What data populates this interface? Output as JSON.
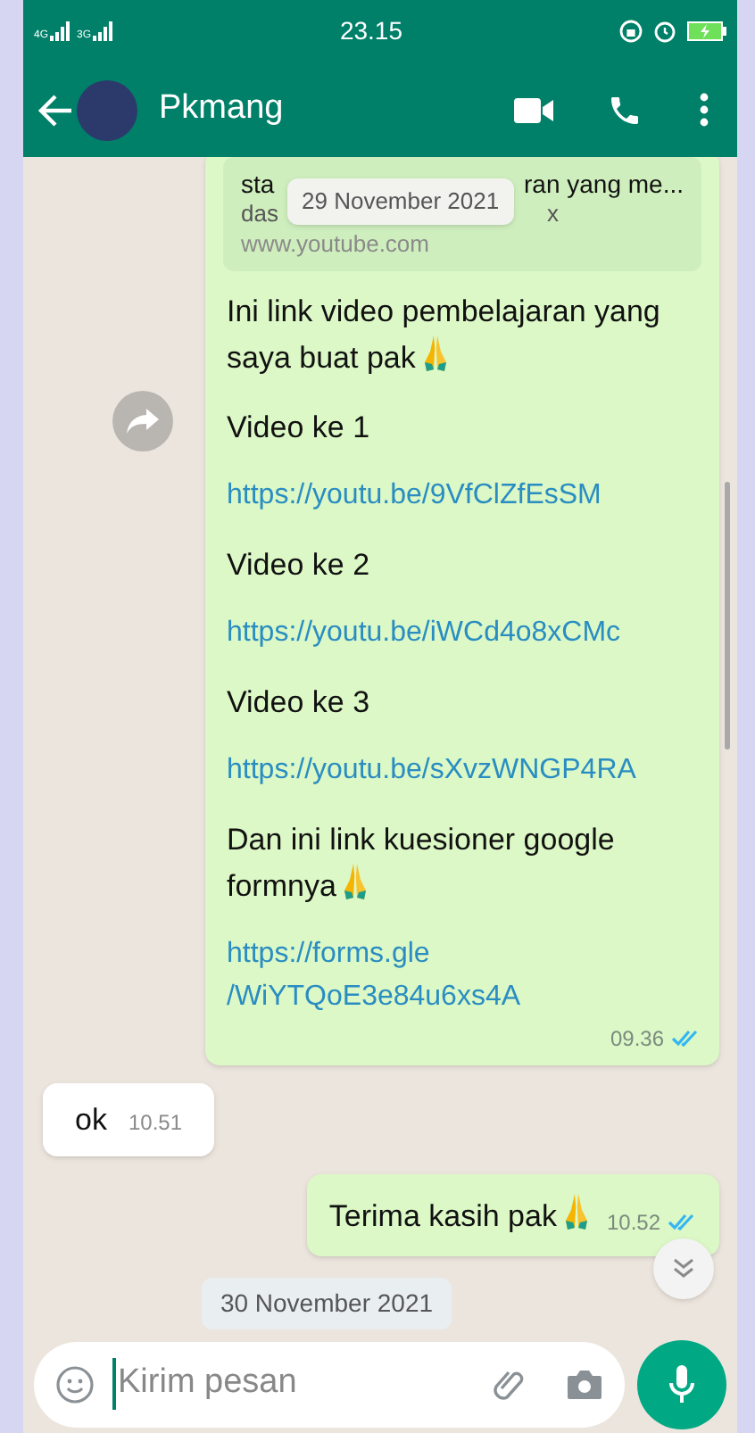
{
  "status_bar": {
    "network_labels": [
      "4G",
      "3G"
    ],
    "time": "23.15"
  },
  "header": {
    "contact_name": "Pkmang"
  },
  "floating_date": "29 November 2021",
  "messages": [
    {
      "kind": "outgoing",
      "preview": {
        "title_parts": [
          "sta",
          "ran yang me..."
        ],
        "description_parts": [
          "das",
          "x"
        ],
        "domain": "www.youtube.com"
      },
      "forward_button": true,
      "lines": [
        {
          "kind": "text_with_praying_emoji",
          "text": "Ini link video pembelajaran yang saya buat pak"
        },
        {
          "kind": "text",
          "text": "Video ke 1"
        },
        {
          "kind": "link",
          "text": "https://youtu.be/9VfClZfEsSM"
        },
        {
          "kind": "text",
          "text": "Video ke 2"
        },
        {
          "kind": "link",
          "text": "https://youtu.be/iWCd4o8xCMc"
        },
        {
          "kind": "text",
          "text": "Video ke 3"
        },
        {
          "kind": "link",
          "text": "https://youtu.be/sXvzWNGP4RA"
        },
        {
          "kind": "text_with_praying_emoji",
          "text": "Dan ini link kuesioner google formnya"
        },
        {
          "kind": "link",
          "text": "https://forms.gle/WiYTQoE3e84u6xs4A"
        }
      ],
      "time": "09.36",
      "read": true
    },
    {
      "kind": "incoming",
      "lines": [
        {
          "kind": "text",
          "text": "ok"
        }
      ],
      "time": "10.51"
    },
    {
      "kind": "outgoing",
      "lines": [
        {
          "kind": "text_with_praying_emoji",
          "text": "Terima kasih pak"
        }
      ],
      "time": "10.52",
      "read": true
    },
    {
      "kind": "date",
      "text": "30 November 2021"
    }
  ],
  "composer": {
    "placeholder": "Kirim pesan"
  }
}
